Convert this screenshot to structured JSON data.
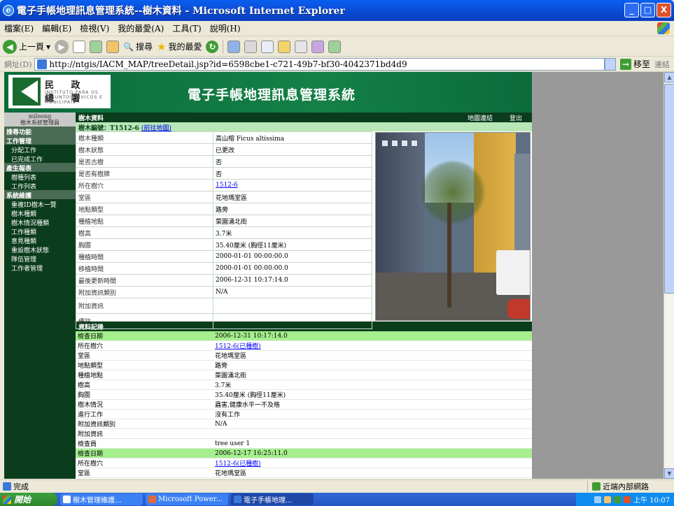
{
  "window": {
    "title": "電子手帳地理訊息管理系統--樹木資料 - Microsoft Internet Explorer",
    "controls": [
      "_",
      "□",
      "X"
    ]
  },
  "menu": [
    "檔案(E)",
    "編輯(E)",
    "檢視(V)",
    "我的最愛(A)",
    "工具(T)",
    "說明(H)"
  ],
  "toolbar": {
    "back_label": "上一頁",
    "search_label": "搜尋",
    "favorites_label": "我的最愛"
  },
  "address": {
    "label": "網址(D)",
    "url": "http://ntgis/IACM_MAP/treeDetail.jsp?id=6598cbe1-c721-49b7-bf30-4042371bd4d9",
    "go_label": "移至",
    "links_label": "連結"
  },
  "header": {
    "logo_title": "民 政 總 署",
    "logo_sub": "INSTITUTO PARA OS ASSUNTOS CIVICOS E MUNICIPAIS",
    "system_title": "電子手帳地理訊息管理系統"
  },
  "nav": {
    "user_name": "mileong",
    "user_role": "樹木系統管理員",
    "sections": [
      {
        "title": "搜尋功能",
        "items": []
      },
      {
        "title": "工作管理",
        "items": [
          "分配工作",
          "已完成工作"
        ]
      },
      {
        "title": "產生報表",
        "items": [
          "樹種列表",
          "工作列表"
        ]
      },
      {
        "title": "系統維護",
        "items": [
          "重複ID樹木一覽",
          "樹木種類",
          "樹木情況種類",
          "工作種類",
          "意見種類",
          "重設樹木狀態",
          "隊伍管理",
          "工作者管理"
        ]
      }
    ]
  },
  "panel": {
    "title": "樹木資料",
    "map_link": "地圖連結",
    "logout": "登出",
    "tree_no_label": "樹木編號：T1512-6",
    "goto_map": "(前往地圖)"
  },
  "info_rows": [
    {
      "k": "樹木種類",
      "v": "高山榕 Ficus altissima"
    },
    {
      "k": "樹木狀態",
      "v": "已更改"
    },
    {
      "k": "是否古樹",
      "v": "否"
    },
    {
      "k": "是否有樹牌",
      "v": "否"
    },
    {
      "k": "所在樹穴",
      "v": "1512-6",
      "link": true
    },
    {
      "k": "堂區",
      "v": "花地瑪堂區"
    },
    {
      "k": "地點類型",
      "v": "路旁"
    },
    {
      "k": "種植地點",
      "v": "菜園涌北街"
    },
    {
      "k": "樹高",
      "v": "3.7米"
    },
    {
      "k": "胸圍",
      "v": "35.40厘米 (胸徑11厘米)"
    },
    {
      "k": "種植時間",
      "v": "2000-01-01 00:00:00.0"
    },
    {
      "k": "移植時間",
      "v": "2000-01-01 00:00:00.0"
    },
    {
      "k": "最後更新時間",
      "v": "2006-12-31 10:17:14.0"
    },
    {
      "k": "附加資訊類別",
      "v": "N/A"
    },
    {
      "k": "附加資訊",
      "v": "",
      "tall": true
    },
    {
      "k": "備註",
      "v": "",
      "tall": true
    }
  ],
  "records_title": "資料記錄",
  "records": [
    {
      "k": "檢查日期",
      "v": "2006-12-31 10:17:14.0",
      "hl": true
    },
    {
      "k": "所在樹穴",
      "v": "1512-6(已種樹)",
      "link": true
    },
    {
      "k": "堂區",
      "v": "花地瑪堂區"
    },
    {
      "k": "地點類型",
      "v": "路旁"
    },
    {
      "k": "種植地點",
      "v": "菜園涌北街"
    },
    {
      "k": "樹高",
      "v": "3.7米"
    },
    {
      "k": "胸圍",
      "v": "35.40厘米 (胸徑11厘米)"
    },
    {
      "k": "樹木情況",
      "v": "蟲害,健康水平一不及格"
    },
    {
      "k": "進行工作",
      "v": "沒有工作"
    },
    {
      "k": "附加資訊類別",
      "v": "N/A"
    },
    {
      "k": "附加資訊",
      "v": ""
    },
    {
      "k": "檢查員",
      "v": "tree user 1"
    },
    {
      "k": "檢查日期",
      "v": "2006-12-17 16:25:11.0",
      "hl": true
    },
    {
      "k": "所在樹穴",
      "v": "1512-6(已種樹)",
      "link": true
    },
    {
      "k": "堂區",
      "v": "花地瑪堂區"
    }
  ],
  "status": {
    "text": "完成",
    "zone": "近端內部網路"
  },
  "taskbar": {
    "start": "開始",
    "tasks": [
      "樹木管理維護...",
      "Microsoft Power...",
      "電子手帳地理..."
    ],
    "clock": "上午 10:07"
  }
}
